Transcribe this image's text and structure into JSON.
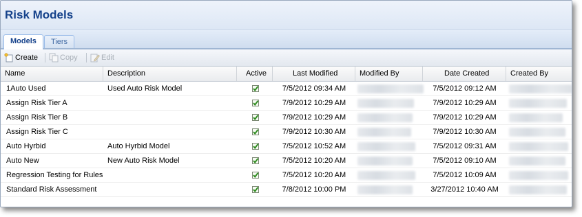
{
  "window": {
    "title": "Risk Models"
  },
  "tabs": [
    {
      "label": "Models",
      "active": true
    },
    {
      "label": "Tiers",
      "active": false
    }
  ],
  "toolbar": {
    "create_label": "Create",
    "copy_label": "Copy",
    "edit_label": "Edit"
  },
  "columns": [
    "Name",
    "Description",
    "Active",
    "Last Modified",
    "Modified By",
    "Date Created",
    "Created By"
  ],
  "rows": [
    {
      "name": "1Auto Used",
      "description": "Used Auto Risk Model",
      "active": true,
      "last_modified": "7/5/2012 09:34 AM",
      "date_created": "7/5/2012 09:12 AM"
    },
    {
      "name": "Assign Risk Tier A",
      "description": "",
      "active": true,
      "last_modified": "7/9/2012 10:29 AM",
      "date_created": "7/9/2012 10:29 AM"
    },
    {
      "name": "Assign Risk Tier B",
      "description": "",
      "active": true,
      "last_modified": "7/9/2012 10:29 AM",
      "date_created": "7/9/2012 10:29 AM"
    },
    {
      "name": "Assign Risk Tier C",
      "description": "",
      "active": true,
      "last_modified": "7/9/2012 10:30 AM",
      "date_created": "7/9/2012 10:30 AM"
    },
    {
      "name": "Auto Hyrbid",
      "description": "Auto Hyrbid Model",
      "active": true,
      "last_modified": "7/5/2012 10:52 AM",
      "date_created": "7/5/2012 09:31 AM"
    },
    {
      "name": "Auto New",
      "description": "New Auto Risk Model",
      "active": true,
      "last_modified": "7/5/2012 10:20 AM",
      "date_created": "7/5/2012 09:10 AM"
    },
    {
      "name": "Regression Testing for Rules",
      "description": "",
      "active": true,
      "last_modified": "7/5/2012 10:20 AM",
      "date_created": "7/5/2012 10:09 AM"
    },
    {
      "name": "Standard Risk Assessment",
      "description": "",
      "active": true,
      "last_modified": "7/8/2012 10:00 PM",
      "date_created": "3/27/2012 10:40 AM"
    }
  ],
  "colors": {
    "title": "#15428b",
    "check": "#2e8b1f",
    "tab_border": "#99bbe8"
  },
  "icons": {
    "create": "create-icon",
    "copy": "copy-icon",
    "edit": "edit-icon",
    "active": "checkbox-checked-icon"
  }
}
